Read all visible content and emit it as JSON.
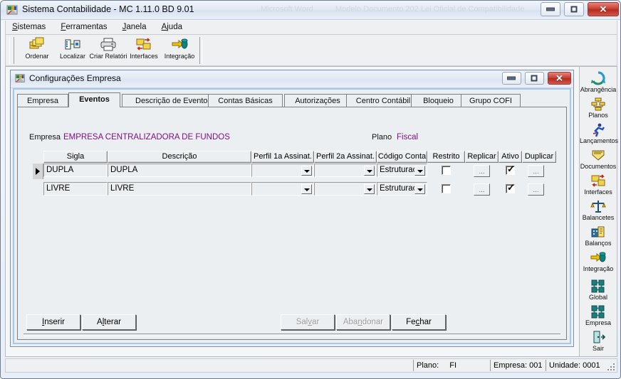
{
  "window": {
    "title": "Sistema Contabilidade -  MC 1.11.0 BD 9.01",
    "icon": "app-icon",
    "ghost1": "Microsoft Word",
    "ghost2": "Modelo Documento  202 Lei Oficial de Compatibilidade",
    "buttons": {
      "minimize": "minimize",
      "maximize": "maximize",
      "close": "close"
    }
  },
  "menubar": {
    "items": [
      {
        "label": "Sistemas",
        "accel": "S"
      },
      {
        "label": "Ferramentas",
        "accel": "F"
      },
      {
        "label": "Janela",
        "accel": "J"
      },
      {
        "label": "Ajuda",
        "accel": "A"
      }
    ]
  },
  "toolbar": {
    "buttons": [
      {
        "label": "Ordenar",
        "icon": "sort-icon"
      },
      {
        "label": "Localizar",
        "icon": "find-icon"
      },
      {
        "label": "Criar Relatóri",
        "icon": "printer-icon"
      },
      {
        "label": "Interfaces",
        "icon": "interfaces-icon"
      },
      {
        "label": "Integração",
        "icon": "integration-icon"
      }
    ]
  },
  "child_window": {
    "title": "Configurações Empresa",
    "icon": "app-icon",
    "buttons": {
      "minimize": "minimize",
      "maximize": "maximize",
      "close": "close"
    }
  },
  "tabs": [
    {
      "label": "Empresa",
      "active": false
    },
    {
      "label": "Eventos",
      "active": true
    },
    {
      "label": "Descrição de Eventos",
      "active": false
    },
    {
      "label": "Contas Básicas",
      "active": false
    },
    {
      "label": "Autorizações",
      "active": false
    },
    {
      "label": "Centro Contábil",
      "active": false
    },
    {
      "label": "Bloqueio",
      "active": false
    },
    {
      "label": "Grupo COFI",
      "active": false
    }
  ],
  "form": {
    "empresa_label": "Empresa",
    "empresa_value": "EMPRESA CENTRALIZADORA DE FUNDOS",
    "plano_label": "Plano",
    "plano_value": "Fiscal",
    "accent_color": "#80108c"
  },
  "grid": {
    "columns": [
      "Sigla",
      "Descrição",
      "Perfil 1a Assinat.",
      "Perfil 2a Assinat.",
      "Código Conta",
      "Restrito",
      "Replicar",
      "Ativo",
      "Duplicar"
    ],
    "rows": [
      {
        "selected": true,
        "sigla": "DUPLA",
        "descricao": "DUPLA",
        "perfil1": "",
        "perfil2": "",
        "codigo_conta": "Estruturac",
        "restrito": false,
        "replicar": "...",
        "ativo": true,
        "duplicar": "..."
      },
      {
        "selected": false,
        "sigla": "LIVRE",
        "descricao": "LIVRE",
        "perfil1": "",
        "perfil2": "",
        "codigo_conta": "Estruturac",
        "restrito": false,
        "replicar": "...",
        "ativo": true,
        "duplicar": "..."
      }
    ]
  },
  "actions": {
    "inserir": {
      "label": "Inserir",
      "accel": "I",
      "enabled": true
    },
    "alterar": {
      "label": "Alterar",
      "accel": "l",
      "enabled": true
    },
    "salvar": {
      "label": "Salvar",
      "accel": "v",
      "enabled": false
    },
    "abandonar": {
      "label": "Abandonar",
      "accel": "n",
      "enabled": false
    },
    "fechar": {
      "label": "Fechar",
      "accel": "c",
      "enabled": true
    }
  },
  "sidebar": {
    "items": [
      {
        "label": "Abrangência",
        "icon": "scope-icon"
      },
      {
        "label": "Planos",
        "icon": "plans-icon"
      },
      {
        "label": "Lançamentos",
        "icon": "entries-icon"
      },
      {
        "label": "Documentos",
        "icon": "documents-icon"
      },
      {
        "label": "Interfaces",
        "icon": "interfaces-icon"
      },
      {
        "label": "Balancetes",
        "icon": "balancetes-icon"
      },
      {
        "label": "Balanços",
        "icon": "balances-icon"
      },
      {
        "label": "Integração",
        "icon": "integration-icon"
      },
      {
        "label": "Global",
        "icon": "global-icon"
      },
      {
        "label": "Empresa",
        "icon": "company-icon"
      },
      {
        "label": "Sair",
        "icon": "exit-icon"
      }
    ]
  },
  "statusbar": {
    "panels": [
      {
        "label": "Plano:",
        "value": "FI"
      },
      {
        "label": "Empresa: 001",
        "value": ""
      },
      {
        "label": "Unidade: 0001",
        "value": ""
      }
    ]
  }
}
